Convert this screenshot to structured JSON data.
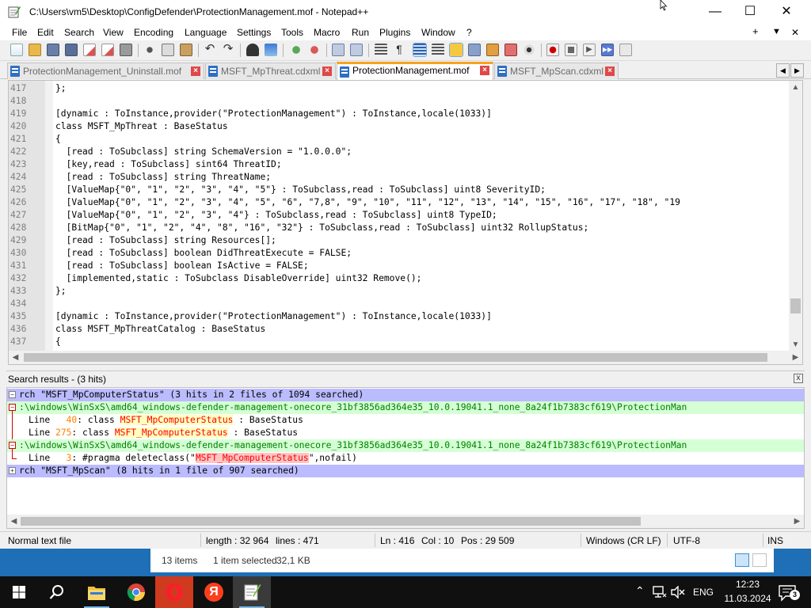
{
  "window": {
    "title": "C:\\Users\\vm5\\Desktop\\ConfigDefender\\ProtectionManagement.mof - Notepad++",
    "min_label": "—",
    "max_label": "☐",
    "close_label": "✕"
  },
  "menu": {
    "items": [
      "File",
      "Edit",
      "Search",
      "View",
      "Encoding",
      "Language",
      "Settings",
      "Tools",
      "Macro",
      "Run",
      "Plugins",
      "Window",
      "?"
    ],
    "right": [
      "+",
      "▼",
      "✕"
    ]
  },
  "tabs": [
    {
      "label": "ProtectionManagement_Uninstall.mof",
      "active": false
    },
    {
      "label": "MSFT_MpThreat.cdxml",
      "active": false
    },
    {
      "label": "ProtectionManagement.mof",
      "active": true
    },
    {
      "label": "MSFT_MpScan.cdxml",
      "active": false
    }
  ],
  "tab_nav": {
    "left": "◀",
    "right": "▶"
  },
  "editor": {
    "lines": [
      {
        "n": "417",
        "code": "};"
      },
      {
        "n": "418",
        "code": ""
      },
      {
        "n": "419",
        "code": "[dynamic : ToInstance,provider(\"ProtectionManagement\") : ToInstance,locale(1033)]"
      },
      {
        "n": "420",
        "code": "class MSFT_MpThreat : BaseStatus"
      },
      {
        "n": "421",
        "code": "{"
      },
      {
        "n": "422",
        "code": "  [read : ToSubclass] string SchemaVersion = \"1.0.0.0\";"
      },
      {
        "n": "423",
        "code": "  [key,read : ToSubclass] sint64 ThreatID;"
      },
      {
        "n": "424",
        "code": "  [read : ToSubclass] string ThreatName;"
      },
      {
        "n": "425",
        "code": "  [ValueMap{\"0\", \"1\", \"2\", \"3\", \"4\", \"5\"} : ToSubclass,read : ToSubclass] uint8 SeverityID;"
      },
      {
        "n": "426",
        "code": "  [ValueMap{\"0\", \"1\", \"2\", \"3\", \"4\", \"5\", \"6\", \"7,8\", \"9\", \"10\", \"11\", \"12\", \"13\", \"14\", \"15\", \"16\", \"17\", \"18\", \"19"
      },
      {
        "n": "427",
        "code": "  [ValueMap{\"0\", \"1\", \"2\", \"3\", \"4\"} : ToSubclass,read : ToSubclass] uint8 TypeID;"
      },
      {
        "n": "428",
        "code": "  [BitMap{\"0\", \"1\", \"2\", \"4\", \"8\", \"16\", \"32\"} : ToSubclass,read : ToSubclass] uint32 RollupStatus;"
      },
      {
        "n": "429",
        "code": "  [read : ToSubclass] string Resources[];"
      },
      {
        "n": "430",
        "code": "  [read : ToSubclass] boolean DidThreatExecute = FALSE;"
      },
      {
        "n": "431",
        "code": "  [read : ToSubclass] boolean IsActive = FALSE;"
      },
      {
        "n": "432",
        "code": "  [implemented,static : ToSubclass DisableOverride] uint32 Remove();"
      },
      {
        "n": "433",
        "code": "};"
      },
      {
        "n": "434",
        "code": ""
      },
      {
        "n": "435",
        "code": "[dynamic : ToInstance,provider(\"ProtectionManagement\") : ToInstance,locale(1033)]"
      },
      {
        "n": "436",
        "code": "class MSFT_MpThreatCatalog : BaseStatus"
      },
      {
        "n": "437",
        "code": "{"
      }
    ]
  },
  "search": {
    "title": "Search results - (3 hits)",
    "close": "x",
    "rows": [
      {
        "type": "hdr",
        "fold": "−",
        "text": "rch \"MSFT_MpComputerStatus\" (3 hits in 2 files of 1094 searched)"
      },
      {
        "type": "file",
        "fold": "−",
        "text": ":\\windows\\WinSxS\\amd64_windows-defender-management-onecore_31bf3856ad364e35_10.0.19041.1_none_8a24f1b7383cf619\\ProtectionMan"
      },
      {
        "type": "hit",
        "pre": "Line  ",
        "num": " 40",
        "mid": ": class ",
        "match": "MSFT_MpComputerStatus",
        "post": " : BaseStatus"
      },
      {
        "type": "hit",
        "pre": "Line ",
        "num": "275",
        "mid": ": class ",
        "match": "MSFT_MpComputerStatus",
        "post": " : BaseStatus"
      },
      {
        "type": "file",
        "fold": "−",
        "text": ":\\windows\\WinSxS\\amd64_windows-defender-management-onecore_31bf3856ad364e35_10.0.19041.1_none_8a24f1b7383cf619\\ProtectionMan"
      },
      {
        "type": "hit2",
        "pre": "Line  ",
        "num": " 3",
        "mid": ": #pragma deleteclass(\"",
        "match": "MSFT_MpComputerStatus",
        "post": "\",nofail)"
      },
      {
        "type": "hdr",
        "fold": "+",
        "text": "rch \"MSFT_MpScan\" (8 hits in 1 file of 907 searched)"
      }
    ]
  },
  "status": {
    "type": "Normal text file",
    "length": "length : 32 964",
    "lines": "lines : 471",
    "ln": "Ln : 416",
    "col": "Col : 10",
    "pos": "Pos : 29 509",
    "eol": "Windows (CR LF)",
    "encoding": "UTF-8",
    "mode": "INS"
  },
  "explorer": {
    "items": "13 items",
    "selected": "1 item selected",
    "size": "32,1 KB"
  },
  "taskbar": {
    "apps": [
      "start-icon",
      "search-icon",
      "file-explorer-icon",
      "chrome-icon",
      "opera-icon",
      "yandex-browser-icon",
      "notepad-plus-plus-icon"
    ],
    "yandex_letter": "Я",
    "lang": "ENG",
    "time": "12:23",
    "date": "11.03.2024",
    "notif_count": "3"
  },
  "colors": {
    "accent_tab": "#f7a31e",
    "search_header": "#bbbbff",
    "search_file": "#d5ffd5",
    "match_text": "#ff0000",
    "taskbar": "#101010"
  }
}
